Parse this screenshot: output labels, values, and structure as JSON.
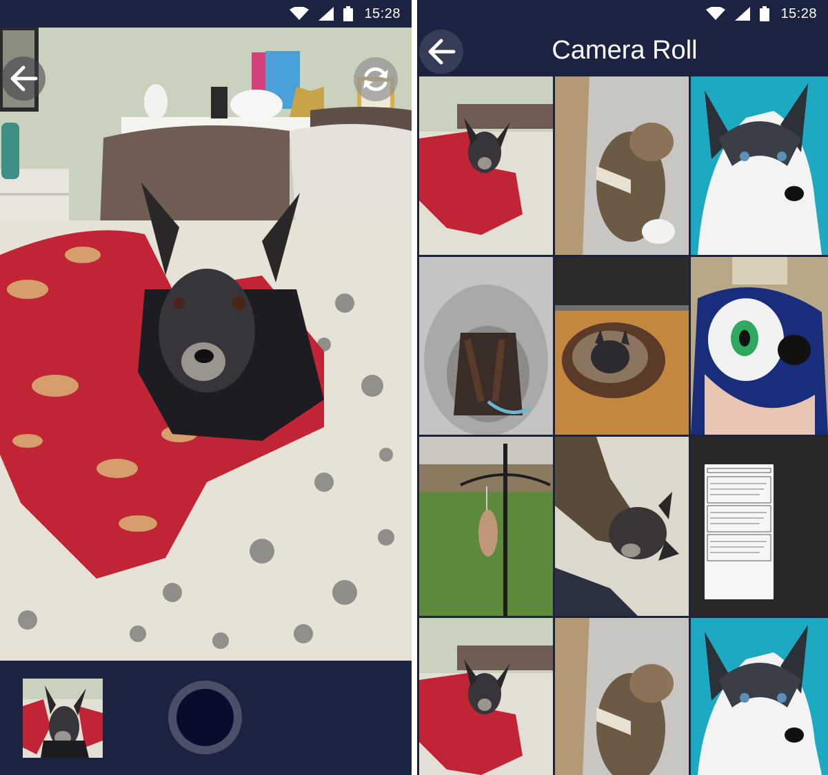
{
  "status_bar": {
    "time": "15:28"
  },
  "camera_screen": {
    "back_icon": "arrow-left-icon",
    "switch_camera_icon": "camera-switch-icon"
  },
  "camera_roll": {
    "title": "Camera Roll",
    "back_icon": "arrow-left-icon"
  },
  "colors": {
    "app_background": "#1b2340",
    "shutter_ring": "#4a5068",
    "shutter_core": "#0a0c2e"
  }
}
